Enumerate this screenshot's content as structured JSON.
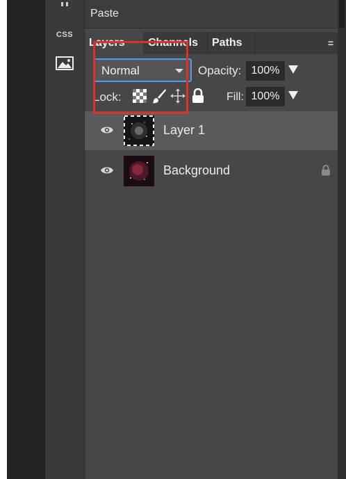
{
  "toolbar": {
    "css_label": "CSS",
    "image_icon": "image-icon"
  },
  "menu": {
    "paste_label": "Paste"
  },
  "tabs": [
    {
      "label": "Layers",
      "active": true
    },
    {
      "label": "Channels",
      "active": false
    },
    {
      "label": "Paths",
      "active": false
    }
  ],
  "panel_menu_icon": "=",
  "controls": {
    "blend_mode": "Normal",
    "opacity_label": "Opacity:",
    "opacity_value": "100%",
    "lock_label": "Lock:",
    "fill_label": "Fill:",
    "fill_value": "100%",
    "lock_icons": [
      "transparency-lock-icon",
      "brush-lock-icon",
      "move-lock-icon",
      "padlock-icon"
    ]
  },
  "layers": [
    {
      "name": "Layer 1",
      "visible": true,
      "selected": true,
      "locked": false
    },
    {
      "name": "Background",
      "visible": true,
      "selected": false,
      "locked": true
    }
  ],
  "colors": {
    "accent": "#4a9ff5",
    "annotation": "#e0302a",
    "panel_bg": "#474747"
  }
}
